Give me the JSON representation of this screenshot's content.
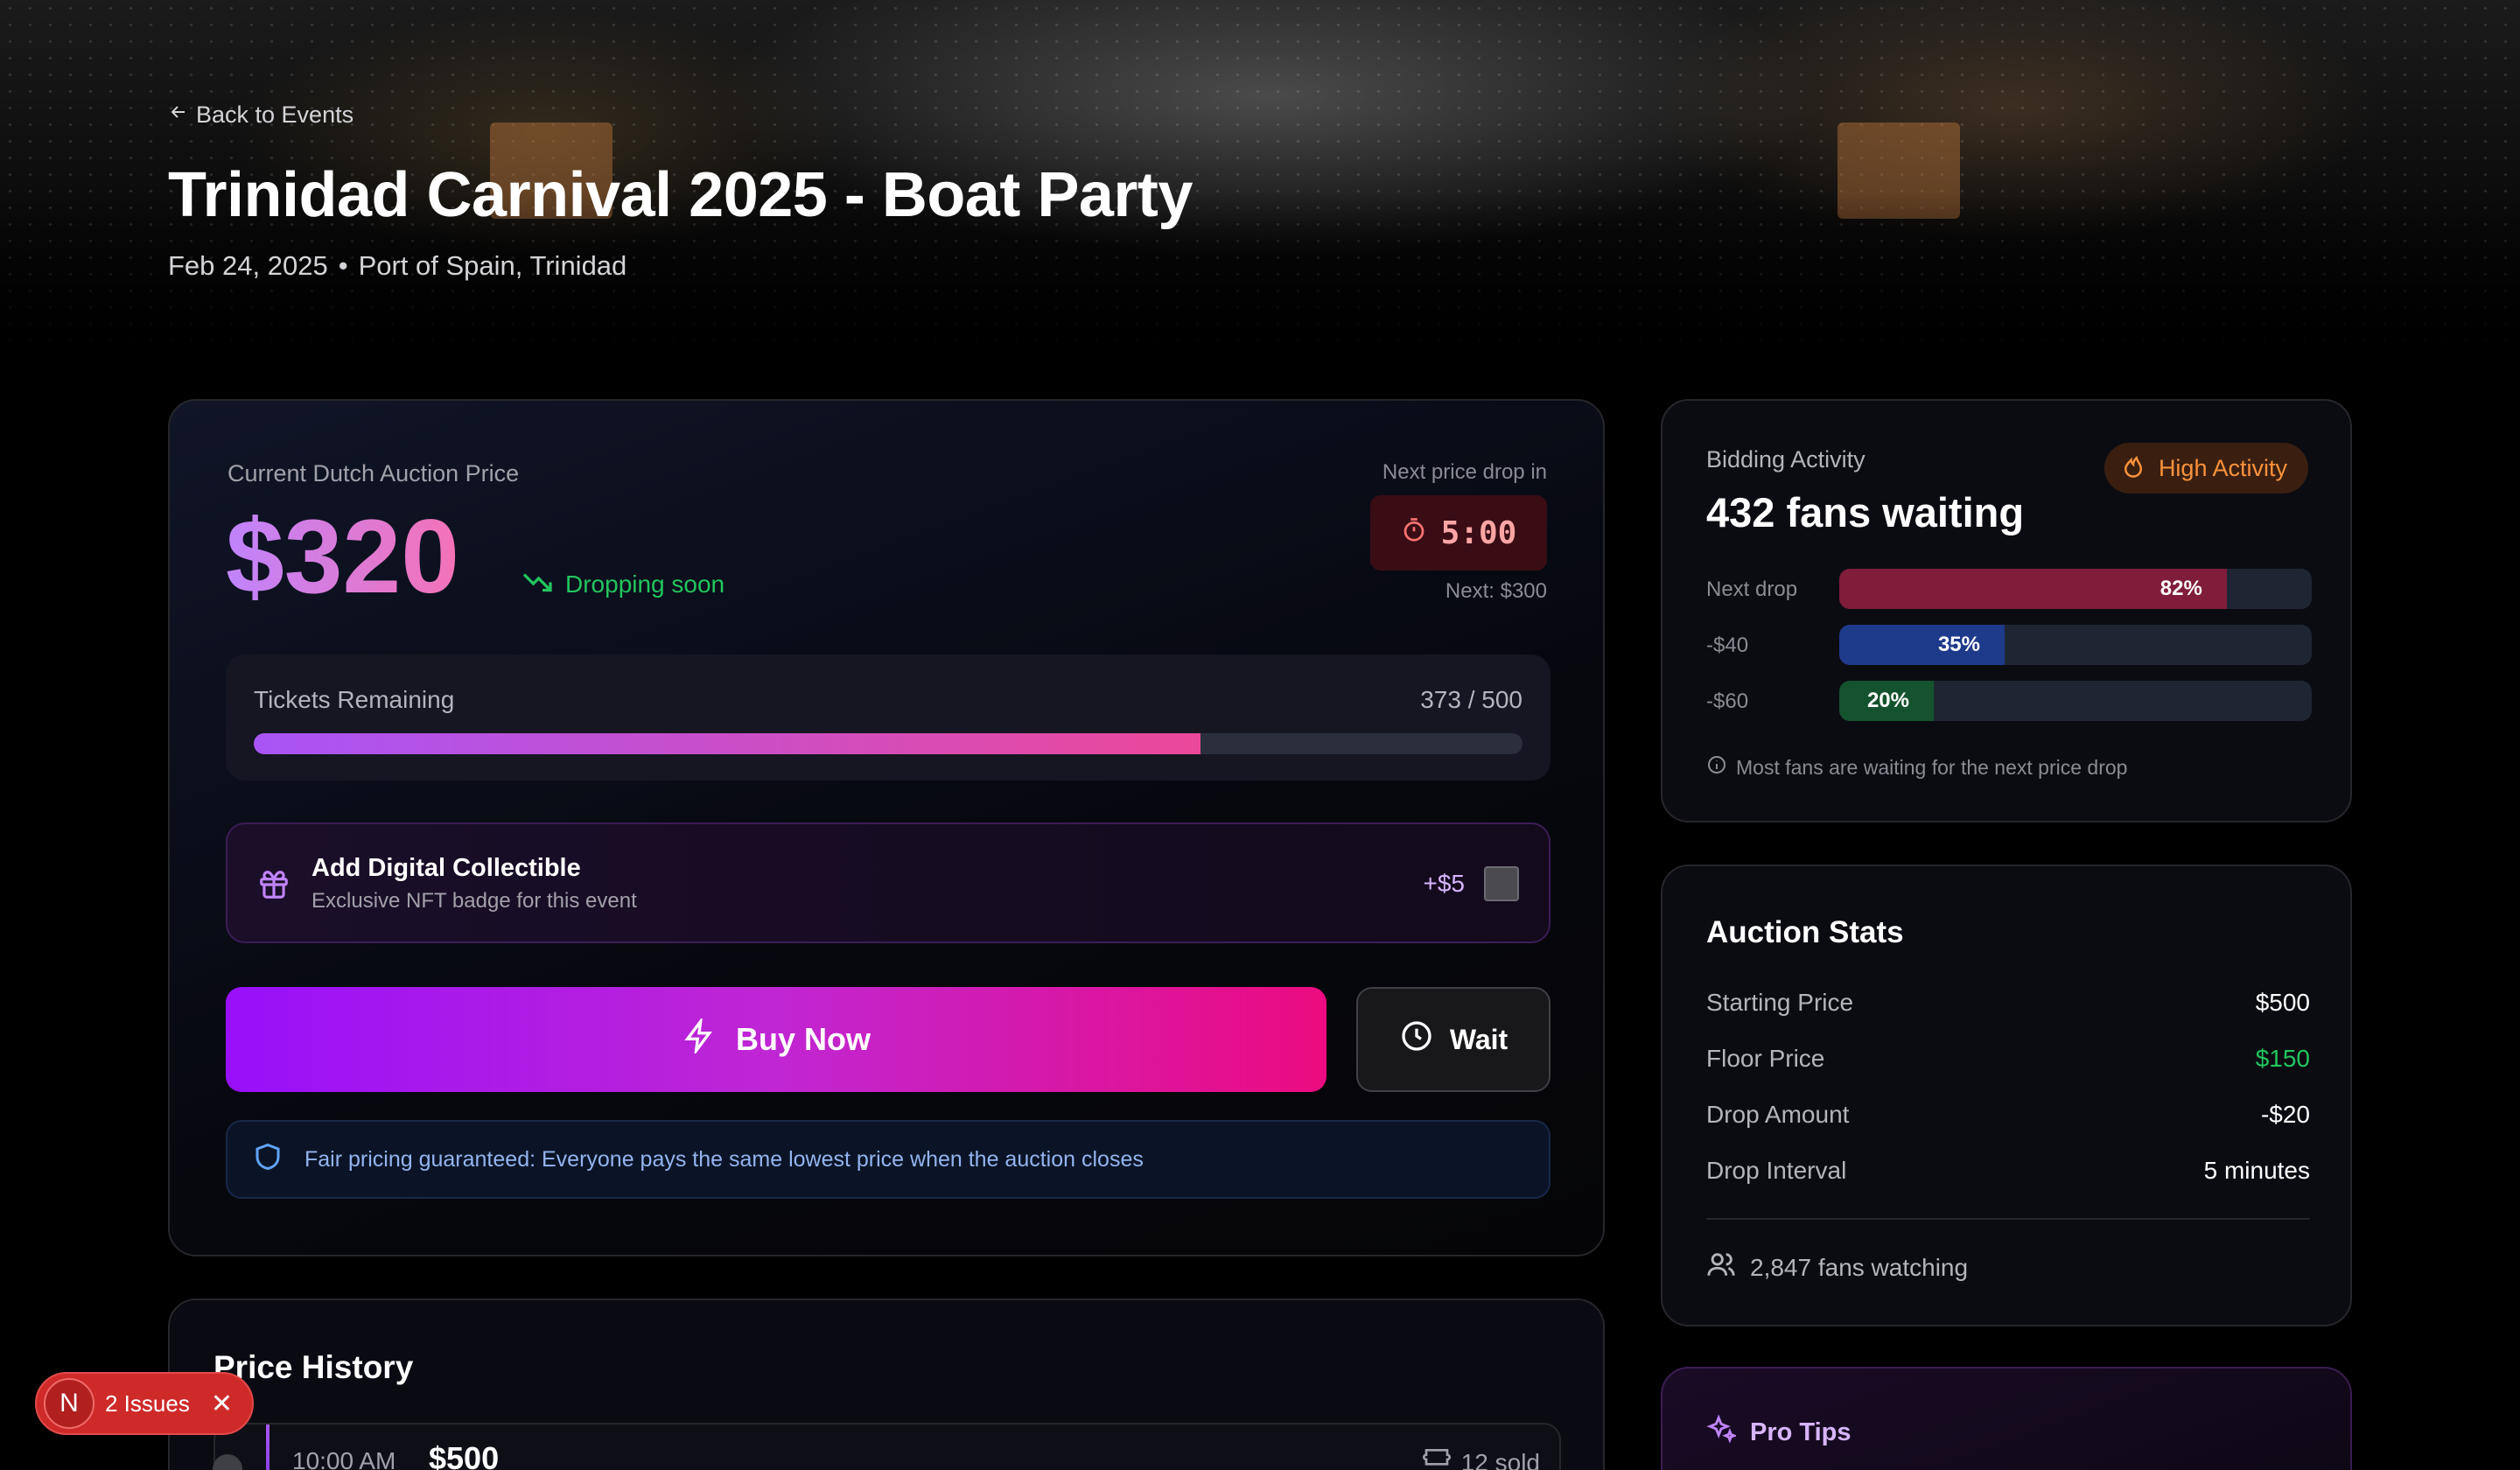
{
  "header": {
    "back_label": "Back to Events",
    "title": "Trinidad Carnival 2025 - Boat Party",
    "date": "Feb 24, 2025",
    "separator": "•",
    "location": "Port of Spain, Trinidad"
  },
  "auction": {
    "price_label": "Current Dutch Auction Price",
    "price": "$320",
    "trend_label": "Dropping soon",
    "next_drop_label": "Next price drop in",
    "timer": "5:00",
    "next_price": "Next: $300",
    "tickets_label": "Tickets Remaining",
    "tickets_count": "373 / 500",
    "tickets_fraction": 0.746,
    "collectible_title": "Add Digital Collectible",
    "collectible_sub": "Exclusive NFT badge for this event",
    "collectible_price": "+$5",
    "buy_label": "Buy Now",
    "wait_label": "Wait",
    "fair_text": "Fair pricing guaranteed: Everyone pays the same lowest price when the auction closes"
  },
  "history": {
    "title": "Price History",
    "rows": [
      {
        "time": "10:00 AM",
        "price": "$500",
        "sold": "12 sold"
      }
    ]
  },
  "activity": {
    "label": "Bidding Activity",
    "headline": "432 fans waiting",
    "badge": "High Activity",
    "rows": [
      {
        "label": "Next drop",
        "percent": 82,
        "text": "82%",
        "color": "#7f1d3a"
      },
      {
        "label": "-$40",
        "percent": 35,
        "text": "35%",
        "color": "#1e3a8a"
      },
      {
        "label": "-$60",
        "percent": 20,
        "text": "20%",
        "color": "#14532d"
      }
    ],
    "note": "Most fans are waiting for the next price drop"
  },
  "stats": {
    "title": "Auction Stats",
    "rows": [
      {
        "key": "Starting Price",
        "value": "$500",
        "color": "#ffffff"
      },
      {
        "key": "Floor Price",
        "value": "$150",
        "color": "#22c55e"
      },
      {
        "key": "Drop Amount",
        "value": "-$20",
        "color": "#ffffff"
      },
      {
        "key": "Drop Interval",
        "value": "5 minutes",
        "color": "#ffffff"
      }
    ],
    "watching": "2,847 fans watching"
  },
  "tips": {
    "title": "Pro Tips"
  },
  "issues": {
    "letter": "N",
    "label": "2 Issues"
  },
  "colors": {
    "accent_purple": "#a855f7",
    "accent_pink": "#ec4899",
    "success": "#22c55e",
    "danger": "#fca5a5"
  }
}
